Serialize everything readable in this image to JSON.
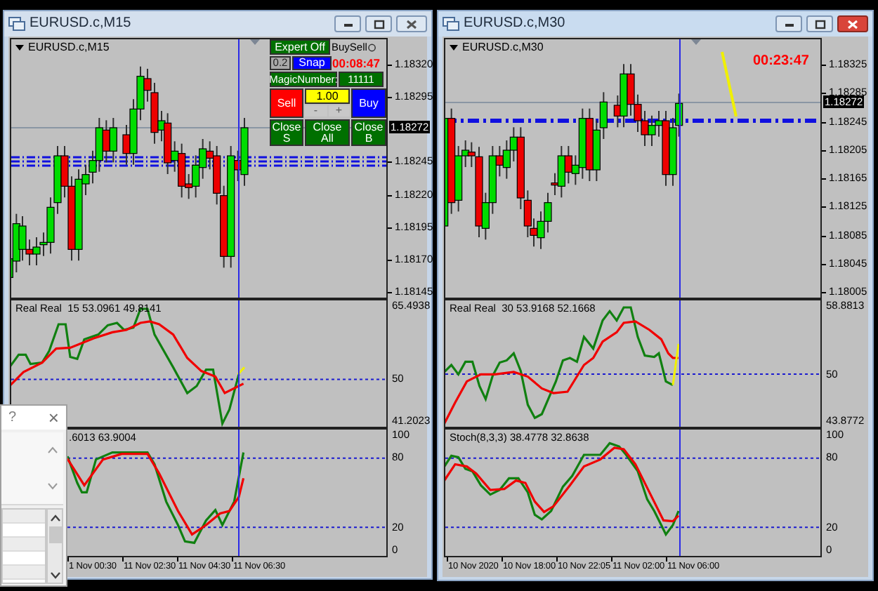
{
  "windows": [
    {
      "title": "EURUSD.c,M15",
      "active": false,
      "symbol_label": "EURUSD.c,M15",
      "price_labels": [
        "1.18320",
        "1.18295",
        "1.18245",
        "1.18220",
        "1.18195",
        "1.18170",
        "1.18145"
      ],
      "current_price": "1.18272",
      "panel": {
        "rows": [
          [
            {
              "kind": "button",
              "text": "Expert Off",
              "color": "#007000"
            },
            {
              "kind": "label",
              "text": "BuySell"
            }
          ],
          [
            {
              "kind": "tag",
              "text": "0.2",
              "color": "#a8a8a8"
            },
            {
              "kind": "button",
              "text": "Snap",
              "color": "#0000ff"
            },
            {
              "kind": "timer",
              "text": "00:08:47"
            }
          ],
          [
            {
              "kind": "tag",
              "text": "MagicNumber:",
              "color": "#007000"
            },
            {
              "kind": "tag",
              "text": "11111",
              "color": "#007000"
            }
          ],
          [
            {
              "kind": "button",
              "text": "Sell",
              "color": "#ff0000"
            },
            {
              "kind": "lot",
              "value": "1.00",
              "minus": "-",
              "plus": "+"
            },
            {
              "kind": "button",
              "text": "Buy",
              "color": "#0000ff"
            }
          ],
          [
            {
              "kind": "button",
              "text": "Close S",
              "color": "#007000"
            },
            {
              "kind": "button",
              "text": "Close All",
              "color": "#007000"
            },
            {
              "kind": "button",
              "text": "Close B",
              "color": "#007000"
            }
          ]
        ]
      },
      "indicators": [
        {
          "label": "Real Real  15 53.0961 49.8141",
          "scale": [
            "65.4938",
            "50",
            "41.2023"
          ]
        },
        {
          "label": ".6013 63.9004",
          "scale": [
            "100",
            "80",
            "20",
            "0"
          ]
        }
      ],
      "time_labels": [
        "1 Nov 00:30",
        "11 Nov 02:30",
        "11 Nov 04:30",
        "11 Nov 06:30"
      ]
    },
    {
      "title": "EURUSD.c,M30",
      "active": true,
      "symbol_label": "EURUSD.c,M30",
      "price_labels": [
        "1.18325",
        "1.18285",
        "1.18245",
        "1.18205",
        "1.18165",
        "1.18125",
        "1.18085",
        "1.18045",
        "1.18005"
      ],
      "current_price": "1.18272",
      "timer": "00:23:47",
      "indicators": [
        {
          "label": "Real Real  30 53.9168 52.1668",
          "scale": [
            "58.8813",
            "50",
            "43.8772"
          ]
        },
        {
          "label": "Stoch(8,3,3) 38.4778 32.8638",
          "scale": [
            "100",
            "80",
            "20",
            "0"
          ]
        }
      ],
      "time_labels": [
        "10 Nov 2020",
        "10 Nov 18:00",
        "10 Nov 22:05",
        "11 Nov 02:00",
        "11 Nov 06:00"
      ]
    }
  ],
  "dialog": {
    "help": "?",
    "close": "×"
  }
}
